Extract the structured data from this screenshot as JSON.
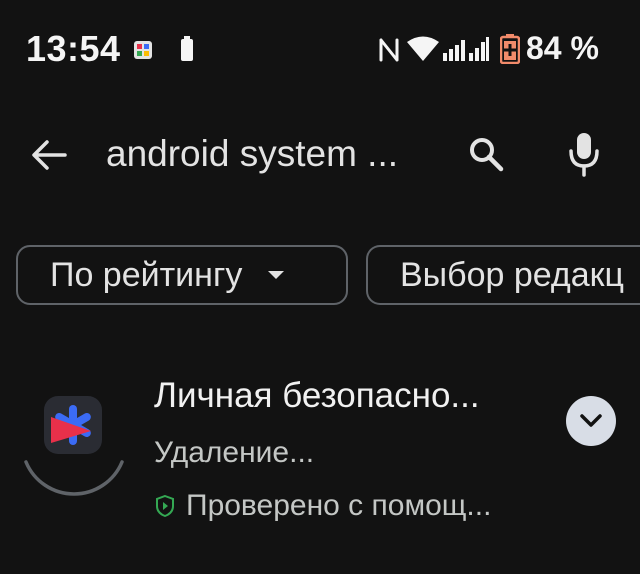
{
  "status_bar": {
    "time": "13:54",
    "battery_percent": "84 %",
    "icons": [
      "notification-app-icon",
      "battery-small-icon",
      "nfc-icon",
      "wifi-icon",
      "signal-icon",
      "battery-saver-icon"
    ]
  },
  "search": {
    "query": "android system ..."
  },
  "chips": {
    "rating_label": "По рейтингу",
    "editors_label": "Выбор редакц"
  },
  "app": {
    "name": "Личная безопасно...",
    "status": "Удаление...",
    "verified": "Проверено с помощ..."
  },
  "colors": {
    "background": "#121212",
    "text": "#e3e3e3",
    "chip_border": "#5f6368",
    "expand_button": "#d8dde6",
    "verified_shield": "#34a853",
    "app_icon_red": "#e8304a",
    "app_icon_blue": "#3b6bf5"
  }
}
